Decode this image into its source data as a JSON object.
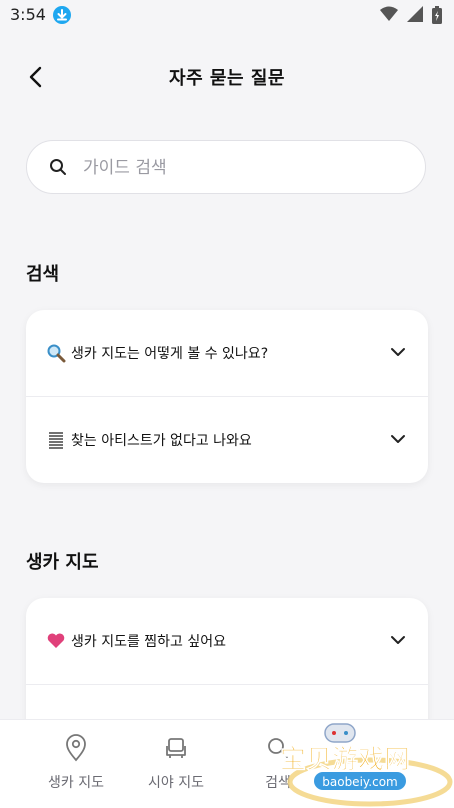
{
  "status_bar": {
    "time": "3:54"
  },
  "header": {
    "title": "자주 묻는 질문"
  },
  "search": {
    "placeholder": "가이드 검색",
    "value": ""
  },
  "sections": [
    {
      "title": "검색",
      "items": [
        {
          "icon": "magnifier-icon",
          "label": "생카 지도는 어떻게 볼 수 있나요?"
        },
        {
          "icon": "list-icon",
          "label": "찾는 아티스트가 없다고 나와요"
        }
      ]
    },
    {
      "title": "생카 지도",
      "items": [
        {
          "icon": "heart-icon",
          "label": "생카 지도를 찜하고 싶어요"
        },
        {
          "icon": "bulb-icon",
          "label": ""
        }
      ]
    }
  ],
  "bottom_nav": [
    {
      "icon": "map-pin-icon",
      "label": "생카 지도"
    },
    {
      "icon": "sofa-icon",
      "label": "시야 지도"
    },
    {
      "icon": "search-icon",
      "label": "검색"
    }
  ],
  "colors": {
    "background": "#f5f5f7",
    "accent_blue": "#1ea7f0",
    "heart": "#e0407a"
  }
}
